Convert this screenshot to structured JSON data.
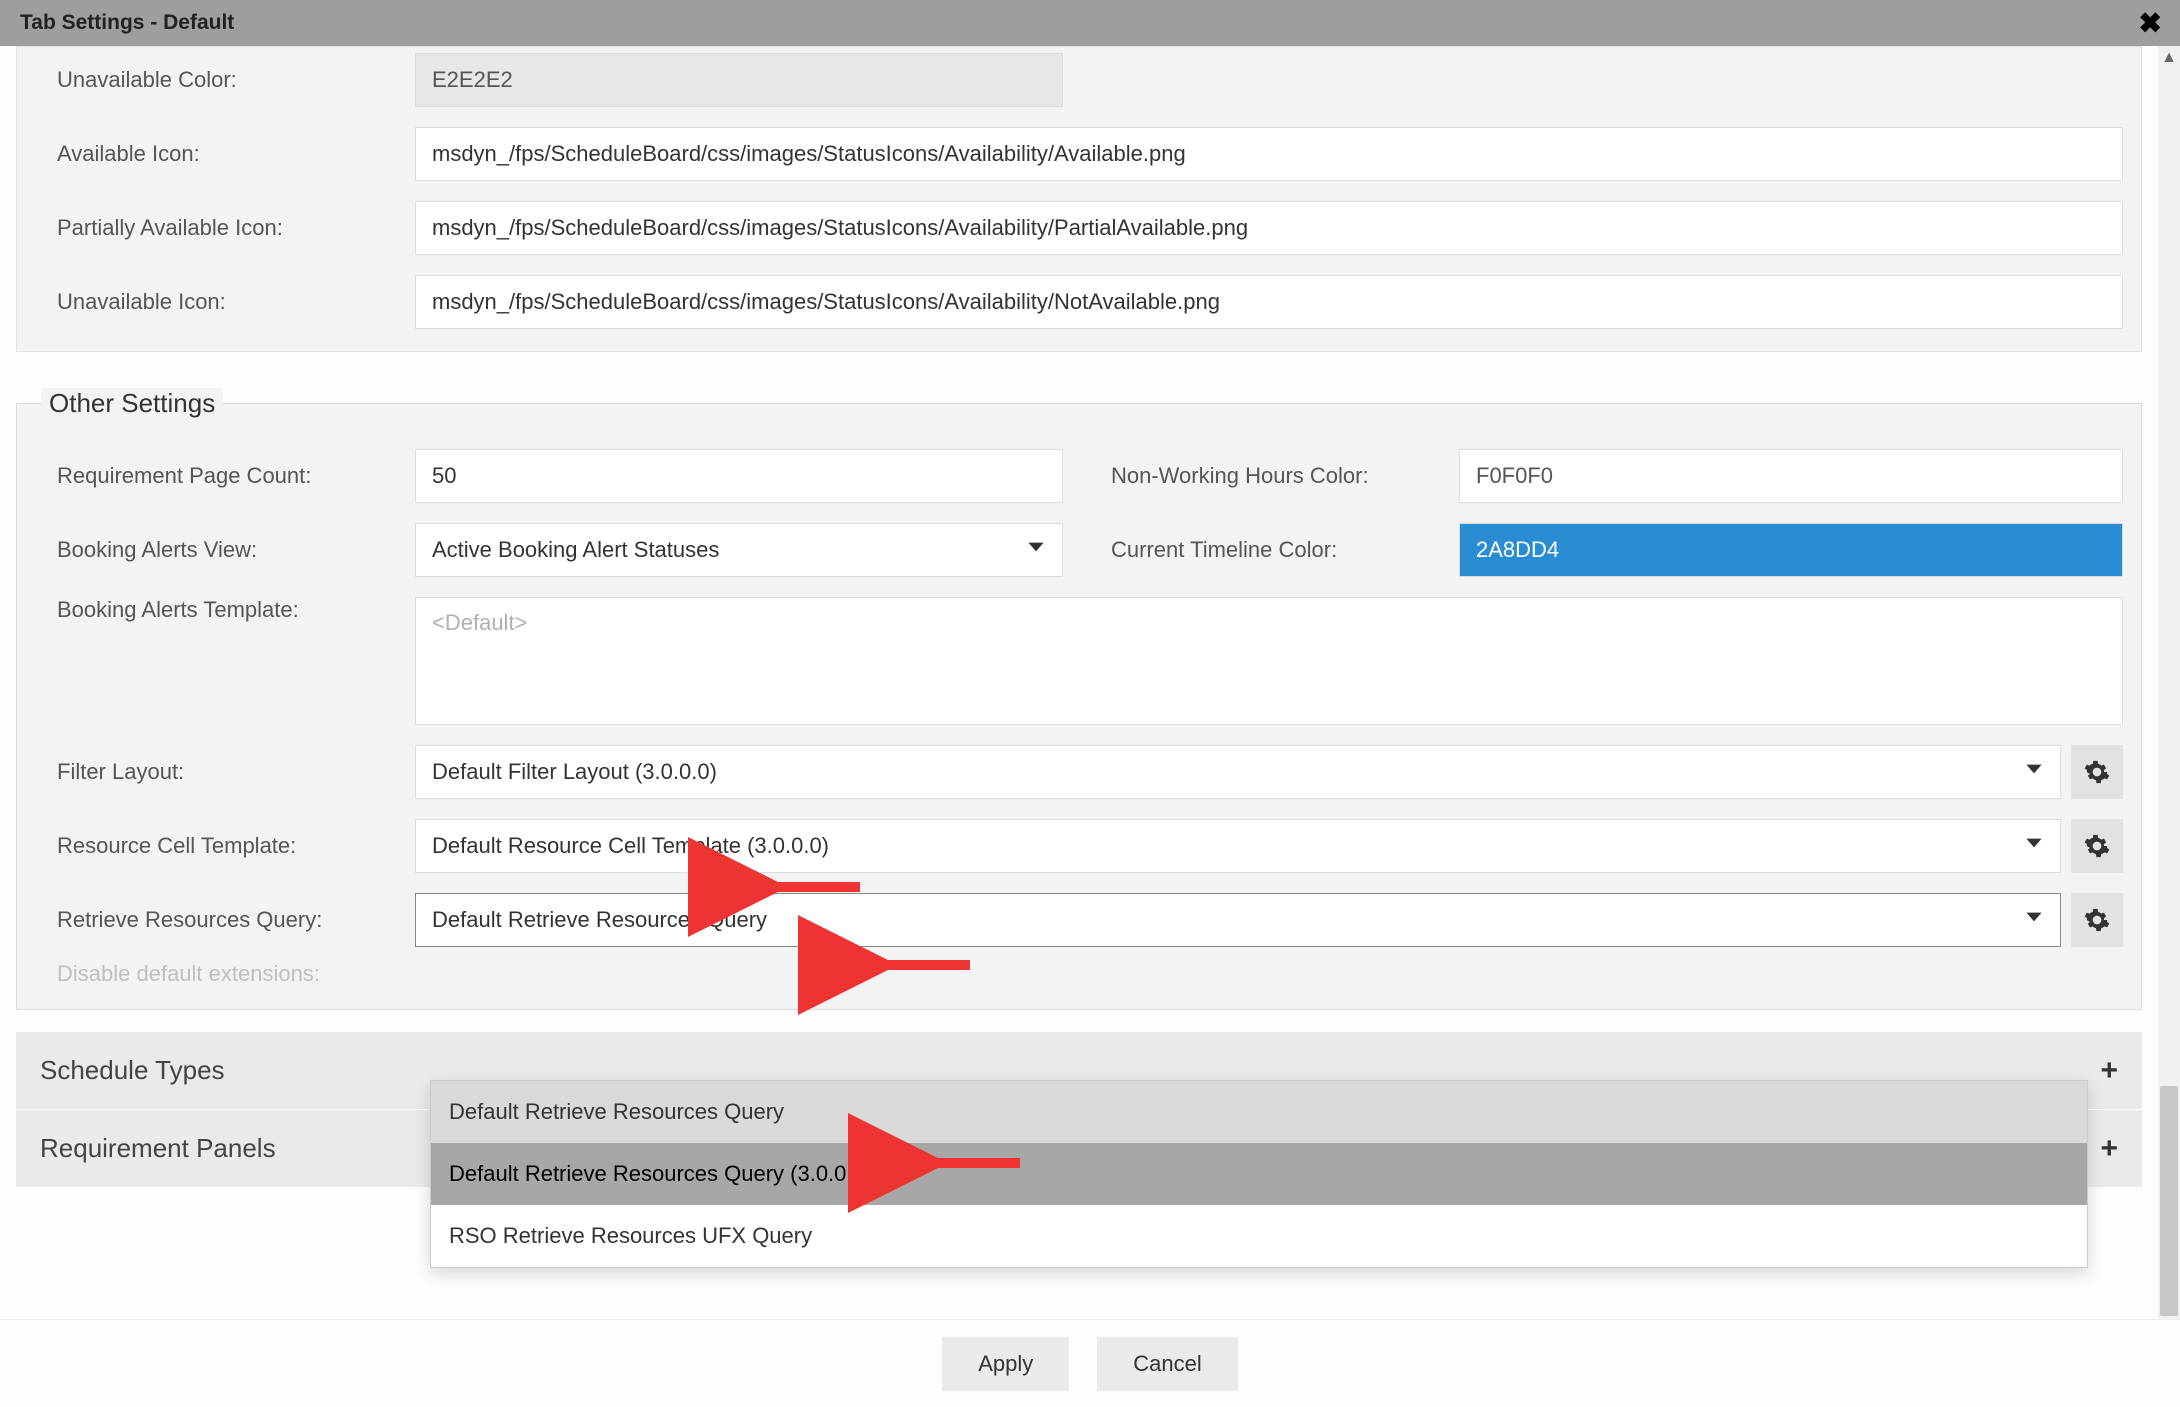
{
  "titlebar": {
    "title": "Tab Settings - Default"
  },
  "top": {
    "unavailable_color": {
      "label": "Unavailable Color:",
      "value": "E2E2E2"
    },
    "available_icon": {
      "label": "Available Icon:",
      "value": "msdyn_/fps/ScheduleBoard/css/images/StatusIcons/Availability/Available.png"
    },
    "partial_icon": {
      "label": "Partially Available Icon:",
      "value": "msdyn_/fps/ScheduleBoard/css/images/StatusIcons/Availability/PartialAvailable.png"
    },
    "unavailable_icon": {
      "label": "Unavailable Icon:",
      "value": "msdyn_/fps/ScheduleBoard/css/images/StatusIcons/Availability/NotAvailable.png"
    }
  },
  "other": {
    "legend": "Other Settings",
    "req_page_count": {
      "label": "Requirement Page Count:",
      "value": "50"
    },
    "nonworking_color": {
      "label": "Non-Working Hours Color:",
      "value": "F0F0F0"
    },
    "alerts_view": {
      "label": "Booking Alerts View:",
      "value": "Active Booking Alert Statuses"
    },
    "timeline_color": {
      "label": "Current Timeline Color:",
      "value": "2A8DD4"
    },
    "alerts_template": {
      "label": "Booking Alerts Template:",
      "placeholder": "<Default>"
    },
    "filter_layout": {
      "label": "Filter Layout:",
      "value": "Default Filter Layout (3.0.0.0)"
    },
    "resource_cell": {
      "label": "Resource Cell Template:",
      "value": "Default Resource Cell Template (3.0.0.0)"
    },
    "retrieve_query": {
      "label": "Retrieve Resources Query:",
      "value": "Default Retrieve Resources Query"
    },
    "retrieve_options": [
      "Default Retrieve Resources Query",
      "Default Retrieve Resources Query (3.0.0.0)",
      "RSO Retrieve Resources UFX Query"
    ],
    "disable_ext": {
      "label": "Disable default extensions:"
    }
  },
  "accordion": {
    "schedule_types": "Schedule Types",
    "requirement_panels": "Requirement Panels"
  },
  "footer": {
    "apply": "Apply",
    "cancel": "Cancel"
  }
}
